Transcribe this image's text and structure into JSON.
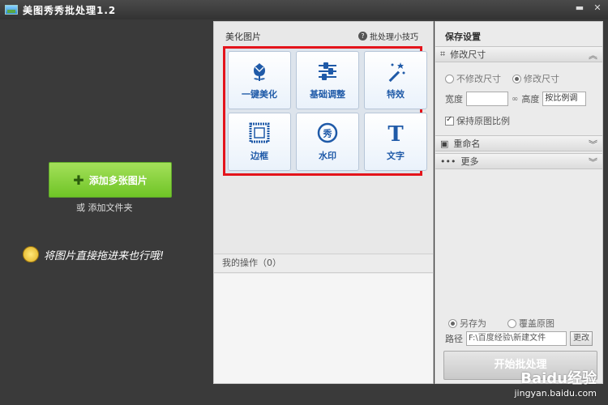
{
  "window": {
    "title": "美图秀秀批处理1.2",
    "min_label": "▬",
    "close_label": "✕"
  },
  "left": {
    "add_button": "添加多张图片",
    "or_text": "或",
    "add_folder": "添加文件夹",
    "drag_hint": "将图片直接拖进来也行哦!"
  },
  "middle": {
    "title": "美化图片",
    "tips": "批处理小技巧",
    "tools": [
      {
        "label": "一键美化",
        "icon": "tulip-icon"
      },
      {
        "label": "基础调整",
        "icon": "sliders-icon"
      },
      {
        "label": "特效",
        "icon": "magic-wand-icon"
      },
      {
        "label": "边框",
        "icon": "frame-icon"
      },
      {
        "label": "水印",
        "icon": "seal-icon"
      },
      {
        "label": "文字",
        "icon": "text-icon"
      }
    ],
    "seal_char": "秀",
    "text_char": "T",
    "my_ops": "我的操作（0）"
  },
  "right": {
    "title": "保存设置",
    "resize_section": "修改尺寸",
    "no_resize": "不修改尺寸",
    "resize": "修改尺寸",
    "width_label": "宽度",
    "height_label": "高度",
    "height_value": "按比例调",
    "keep_ratio": "保持原图比例",
    "rename_section": "重命名",
    "more_section": "更多",
    "save_as": "另存为",
    "overwrite": "覆盖原图",
    "path_label": "路径",
    "path_value": "F:\\百度经验\\新建文件",
    "change_btn": "更改",
    "start_btn": "开始批处理"
  },
  "watermark": {
    "brand": "Baidu经验",
    "url": "jingyan.baidu.com"
  }
}
